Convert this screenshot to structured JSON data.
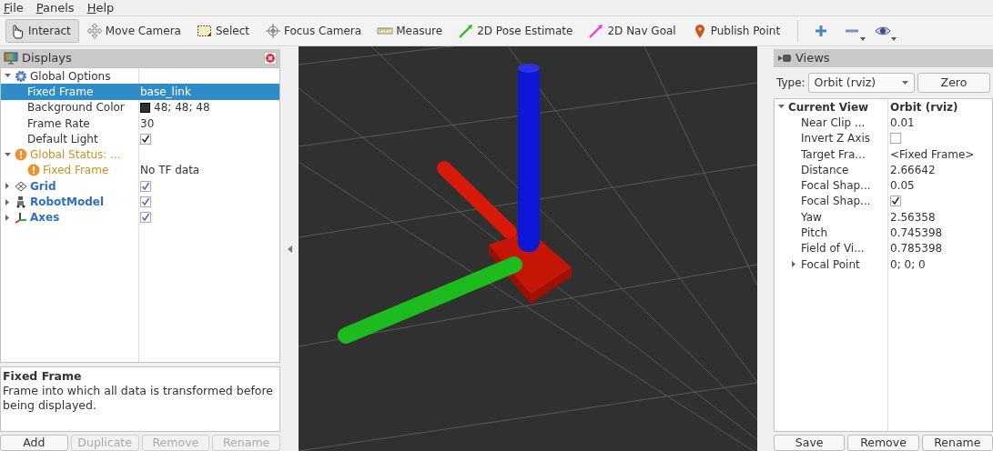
{
  "menu": [
    {
      "label": "File"
    },
    {
      "label": "Panels"
    },
    {
      "label": "Help"
    }
  ],
  "tools": [
    {
      "label": "Interact",
      "selected": true
    },
    {
      "label": "Move Camera",
      "selected": false
    },
    {
      "label": "Select",
      "selected": false
    },
    {
      "label": "Focus Camera",
      "selected": false
    },
    {
      "label": "Measure",
      "selected": false
    },
    {
      "label": "2D Pose Estimate",
      "selected": false
    },
    {
      "label": "2D Nav Goal",
      "selected": false
    },
    {
      "label": "Publish Point",
      "selected": false
    }
  ],
  "displays": {
    "title": "Displays",
    "tree": [
      {
        "label": "Global Options",
        "kind": "options",
        "expanded": true,
        "selected": false,
        "children": [
          {
            "label": "Fixed Frame",
            "kind": "text",
            "value": "base_link",
            "selected": true
          },
          {
            "label": "Background Color",
            "kind": "color",
            "value": "48; 48; 48",
            "color": "#303030",
            "selected": false
          },
          {
            "label": "Frame Rate",
            "kind": "text",
            "value": "30",
            "selected": false
          },
          {
            "label": "Default Light",
            "kind": "check",
            "checked": true,
            "selected": false
          }
        ]
      },
      {
        "label": "Global Status: ...",
        "kind": "status",
        "expanded": true,
        "selected": false,
        "children": [
          {
            "label": "Fixed Frame",
            "kind": "status",
            "value": "No TF data",
            "selected": false
          }
        ]
      },
      {
        "label": "Grid",
        "kind": "display",
        "expanded": false,
        "checked": true,
        "selected": false
      },
      {
        "label": "RobotModel",
        "kind": "display",
        "expanded": false,
        "checked": true,
        "selected": false
      },
      {
        "label": "Axes",
        "kind": "display",
        "expanded": false,
        "checked": true,
        "selected": false
      }
    ],
    "description": {
      "title": "Fixed Frame",
      "text": "Frame into which all data is transformed before being displayed."
    },
    "buttons": [
      {
        "label": "Add",
        "disabled": false
      },
      {
        "label": "Duplicate",
        "disabled": true
      },
      {
        "label": "Remove",
        "disabled": true
      },
      {
        "label": "Rename",
        "disabled": true
      }
    ]
  },
  "views": {
    "title": "Views",
    "type_label": "Type:",
    "type_value": "Orbit (rviz)",
    "zero_button": "Zero",
    "tree": [
      {
        "label": "Current View",
        "kind": "view",
        "value": "Orbit (rviz)",
        "expanded": true,
        "selected": false,
        "children": [
          {
            "label": "Near Clip ...",
            "kind": "text",
            "value": "0.01",
            "selected": false
          },
          {
            "label": "Invert Z Axis",
            "kind": "check",
            "checked": false,
            "selected": false
          },
          {
            "label": "Target Fra...",
            "kind": "text",
            "value": "<Fixed Frame>",
            "selected": false
          },
          {
            "label": "Distance",
            "kind": "text",
            "value": "2.66642",
            "selected": false
          },
          {
            "label": "Focal Shap...",
            "kind": "text",
            "value": "0.05",
            "selected": false
          },
          {
            "label": "Focal Shap...",
            "kind": "check",
            "checked": true,
            "selected": false
          },
          {
            "label": "Yaw",
            "kind": "text",
            "value": "2.56358",
            "selected": false
          },
          {
            "label": "Pitch",
            "kind": "text",
            "value": "0.745398",
            "selected": false
          },
          {
            "label": "Field of Vi...",
            "kind": "text",
            "value": "0.785398",
            "selected": false
          },
          {
            "label": "Focal Point",
            "kind": "text",
            "value": "0; 0; 0",
            "expanded": false,
            "selected": false
          }
        ]
      }
    ],
    "buttons": [
      {
        "label": "Save",
        "disabled": false
      },
      {
        "label": "Remove",
        "disabled": false
      },
      {
        "label": "Rename",
        "disabled": false
      }
    ]
  }
}
